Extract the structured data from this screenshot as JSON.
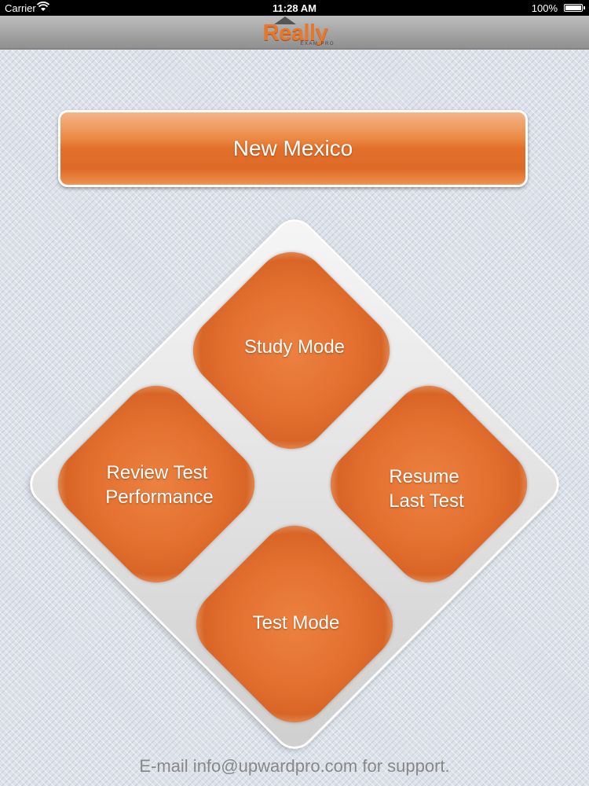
{
  "status_bar": {
    "carrier": "Carrier",
    "time": "11:28 AM",
    "battery": "100%"
  },
  "nav": {
    "logo_text": "Really",
    "logo_subtext": "EXAM PRO"
  },
  "state": {
    "name": "New Mexico"
  },
  "menu": {
    "study_mode": "Study Mode",
    "review_line1": "Review Test",
    "review_line2": "Performance",
    "resume_line1": "Resume",
    "resume_line2": "Last Test",
    "test_mode": "Test Mode"
  },
  "footer": {
    "support_text": "E-mail info@upwardpro.com for support."
  },
  "colors": {
    "accent_orange": "#e47030",
    "background": "#dde2ea"
  }
}
